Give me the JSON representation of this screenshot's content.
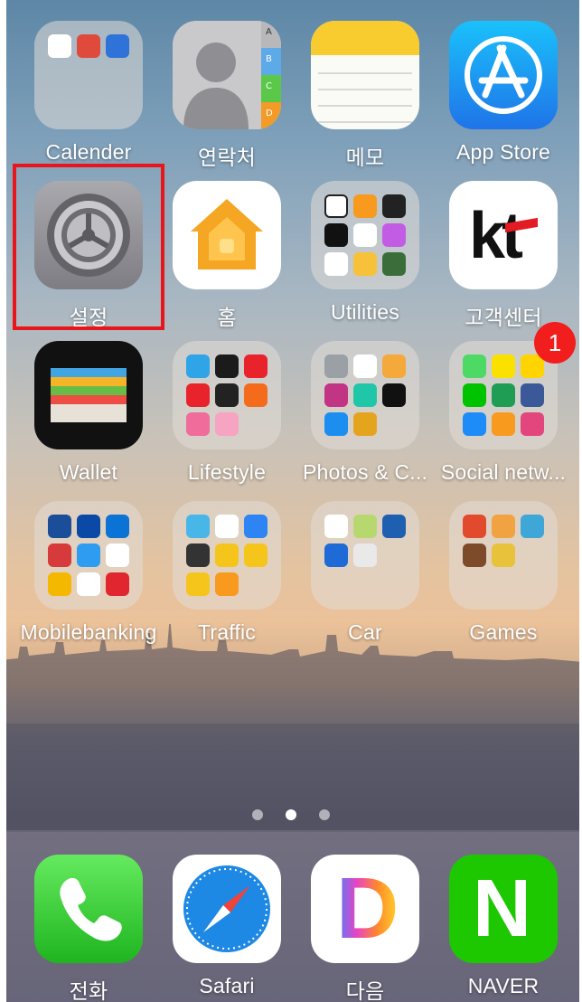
{
  "home_screen": {
    "apps": [
      {
        "id": "calender",
        "label": "Calender",
        "type": "folder"
      },
      {
        "id": "contacts",
        "label": "연락처",
        "type": "app"
      },
      {
        "id": "notes",
        "label": "메모",
        "type": "app"
      },
      {
        "id": "app-store",
        "label": "App Store",
        "type": "app"
      },
      {
        "id": "settings",
        "label": "설정",
        "type": "app",
        "highlighted": true
      },
      {
        "id": "home",
        "label": "홈",
        "type": "app"
      },
      {
        "id": "utilities",
        "label": "Utilities",
        "type": "folder"
      },
      {
        "id": "kt",
        "label": "고객센터",
        "type": "app"
      },
      {
        "id": "wallet",
        "label": "Wallet",
        "type": "app"
      },
      {
        "id": "lifestyle",
        "label": "Lifestyle",
        "type": "folder"
      },
      {
        "id": "photos",
        "label": "Photos & C...",
        "type": "folder"
      },
      {
        "id": "social",
        "label": "Social netw...",
        "type": "folder",
        "badge": "1"
      },
      {
        "id": "mobile-banking",
        "label": "Mobilebanking",
        "type": "folder"
      },
      {
        "id": "traffic",
        "label": "Traffic",
        "type": "folder"
      },
      {
        "id": "car",
        "label": "Car",
        "type": "folder"
      },
      {
        "id": "games",
        "label": "Games",
        "type": "folder"
      }
    ],
    "contacts_tabs": [
      "A",
      "B",
      "C",
      "D"
    ],
    "kt_logo_text": "kt",
    "naver_logo_text": "N",
    "daum_logo_text": "D",
    "page_indicator": {
      "pages": 3,
      "current": 2
    }
  },
  "dock": {
    "apps": [
      {
        "id": "phone",
        "label": "전화"
      },
      {
        "id": "safari",
        "label": "Safari"
      },
      {
        "id": "daum",
        "label": "다음"
      },
      {
        "id": "naver",
        "label": "NAVER"
      }
    ]
  },
  "colors": {
    "highlight_border": "#e8151b",
    "badge": "#f21d1d",
    "naver_green": "#1ec800",
    "phone_green": "#4cd964"
  }
}
